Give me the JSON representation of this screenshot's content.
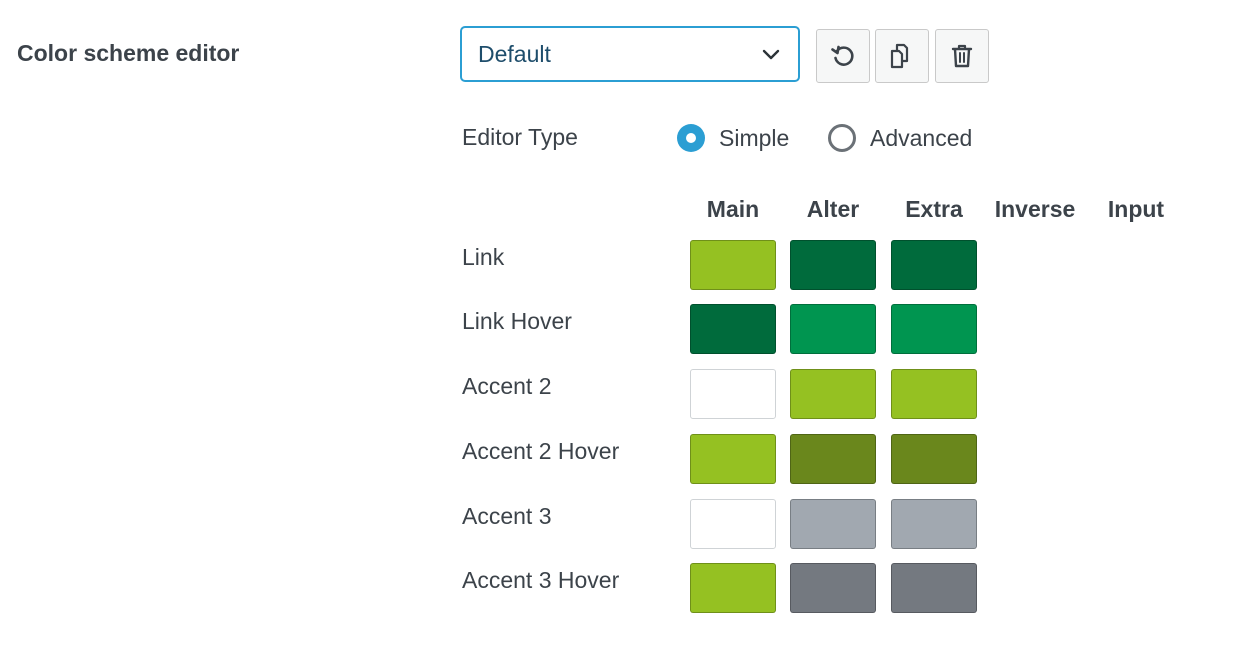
{
  "section": {
    "title": "Color scheme editor"
  },
  "scheme_select": {
    "value": "Default"
  },
  "toolbar": {
    "reset_icon": "reset-icon",
    "copy_icon": "copy-icon",
    "delete_icon": "trash-icon"
  },
  "editor_type": {
    "label": "Editor Type",
    "options": [
      {
        "label": "Simple",
        "checked": true
      },
      {
        "label": "Advanced",
        "checked": false
      }
    ]
  },
  "columns": [
    "Main",
    "Alter",
    "Extra",
    "Inverse",
    "Input"
  ],
  "rows": [
    {
      "label": "Link",
      "colors": [
        "#95c122",
        "#006b3c",
        "#006b3c"
      ]
    },
    {
      "label": "Link Hover",
      "colors": [
        "#006b3c",
        "#009550",
        "#009550"
      ]
    },
    {
      "label": "Accent 2",
      "colors": [
        "#ffffff",
        "#95c122",
        "#95c122"
      ]
    },
    {
      "label": "Accent 2 Hover",
      "colors": [
        "#95c122",
        "#6a871c",
        "#6a871c"
      ]
    },
    {
      "label": "Accent 3",
      "colors": [
        "#ffffff",
        "#a1a8b0",
        "#a1a8b0"
      ]
    },
    {
      "label": "Accent 3 Hover",
      "colors": [
        "#95c122",
        "#747980",
        "#747980"
      ]
    }
  ],
  "accent_color": "#2b9ed3"
}
